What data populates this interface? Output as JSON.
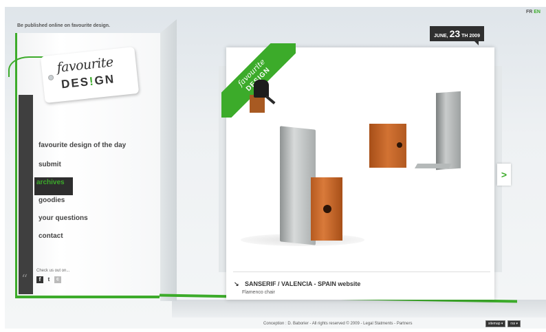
{
  "header": {
    "lang_fr": "FR",
    "lang_en": "EN",
    "tagline": "Be published online on favourite design."
  },
  "logo": {
    "line1": "favourite",
    "line2_pre": "DES",
    "line2_ex": "!",
    "line2_post": "GN"
  },
  "date": {
    "month": "JUNE,",
    "day": "23",
    "suffix": "TH 2009"
  },
  "ribbon": {
    "line1": "favourite",
    "line2": "DESIGN"
  },
  "nav": {
    "items": [
      {
        "label": "favourite design of the day"
      },
      {
        "label": "submit"
      },
      {
        "label": "archives"
      },
      {
        "label": "goodies"
      },
      {
        "label": "your questions"
      },
      {
        "label": "contact"
      }
    ],
    "active_index": 2
  },
  "social": {
    "check_us": "Check us out on...",
    "facebook": "f",
    "twitter": "t",
    "cc": "c",
    "quote_glyph": "“"
  },
  "caption": {
    "arrow": "↘",
    "title": "SANSERIF / VALENCIA - SPAIN website",
    "subtitle": "Flamenco chair"
  },
  "next_glyph": ">",
  "footer": {
    "credits": "Conception : D. Baborier - All rights reserved © 2009 - Legal Statments - Partners",
    "btn1": "sitemap ▾",
    "btn2": "rss ▾"
  },
  "colors": {
    "accent": "#3cab2a",
    "dark": "#2f2f2f"
  }
}
